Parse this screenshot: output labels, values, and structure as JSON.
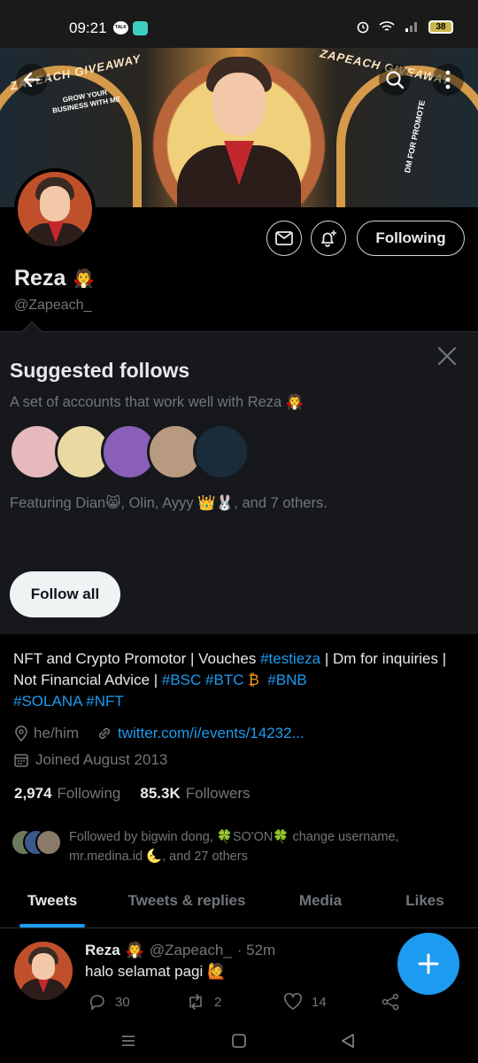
{
  "status_bar": {
    "time": "09:21",
    "notif_badge": "TALK",
    "battery": "38"
  },
  "banner": {
    "text_left": "ZAPEACH GIVEAWAY",
    "text_right": "ZAPEACH GIVEAWAY",
    "grow_line1": "GROW YOUR",
    "grow_line2": "BUSINESS WITH ME",
    "dm_text": "DM FOR PROMOTE"
  },
  "profile": {
    "name": "Reza",
    "name_emoji": "🧛",
    "handle": "@Zapeach_",
    "following_label": "Following"
  },
  "suggested": {
    "title": "Suggested follows",
    "subtitle": "A set of accounts that work well with Reza 🧛",
    "featuring": "Featuring Dian😸, Olin, Ayyy 👑🐰, and 7 others.",
    "follow_all_label": "Follow all",
    "avatar_colors": [
      "#e7b8bd",
      "#e9d9a2",
      "#8a5fb8",
      "#b89a80",
      "#1a2b3a"
    ]
  },
  "bio": {
    "part1": "NFT and Crypto Promotor | Vouches ",
    "tag1": "#testieza",
    "part2": " | Dm for inquiries | Not Financial Advice | ",
    "tag2": "#BSC",
    "tag3": "#BTC",
    "btc_emoji": "₿",
    "tag4": "#BNB",
    "tag5": "#SOLANA",
    "tag6": "#NFT"
  },
  "meta": {
    "pronouns": "he/him",
    "link": "twitter.com/i/events/14232...",
    "joined": "Joined August 2013"
  },
  "counts": {
    "following_num": "2,974",
    "following_label": "Following",
    "followers_num": "85.3K",
    "followers_label": "Followers"
  },
  "followed_by": {
    "text": "Followed by bigwin dong, 🍀SO'ON🍀 change username, mr.medina.id 🌜, and 27 others"
  },
  "tabs": [
    {
      "label": "Tweets"
    },
    {
      "label": "Tweets & replies"
    },
    {
      "label": "Media"
    },
    {
      "label": "Likes"
    }
  ],
  "tweet": {
    "name": "Reza",
    "emoji": "🧛",
    "handle": "@Zapeach_",
    "time": "· 52m",
    "body": "halo selamat pagi 🙋",
    "replies": "30",
    "retweets": "2",
    "likes": "14"
  },
  "colors": {
    "accent": "#1d9bf0",
    "background": "#000000",
    "card": "#16181c"
  }
}
